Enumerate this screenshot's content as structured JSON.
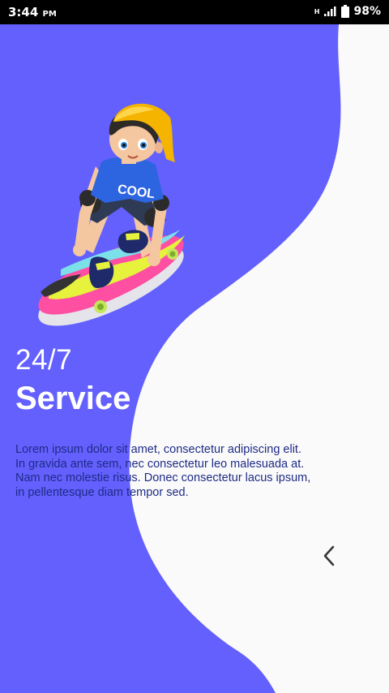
{
  "status_bar": {
    "time": "3:44",
    "ampm": "PM",
    "network_type": "H",
    "battery_percent": "98%"
  },
  "colors": {
    "accent": "#6360fd",
    "background": "#fafafa",
    "description_text": "#1e2b86"
  },
  "onboarding": {
    "title_line1": "24/7",
    "title_line2": "Service",
    "description": "Lorem ipsum dolor sit amet, consectetur adipiscing elit. In gravida ante sem, nec consectetur leo malesuada at. Nam nec molestie risus. Donec consectetur lacus ipsum, in pellentesque diam tempor sed."
  },
  "icons": {
    "illustration": "skateboarder-illustration",
    "navigation": "chevron-left-icon",
    "signal": "signal-bars-icon",
    "battery": "battery-icon"
  }
}
